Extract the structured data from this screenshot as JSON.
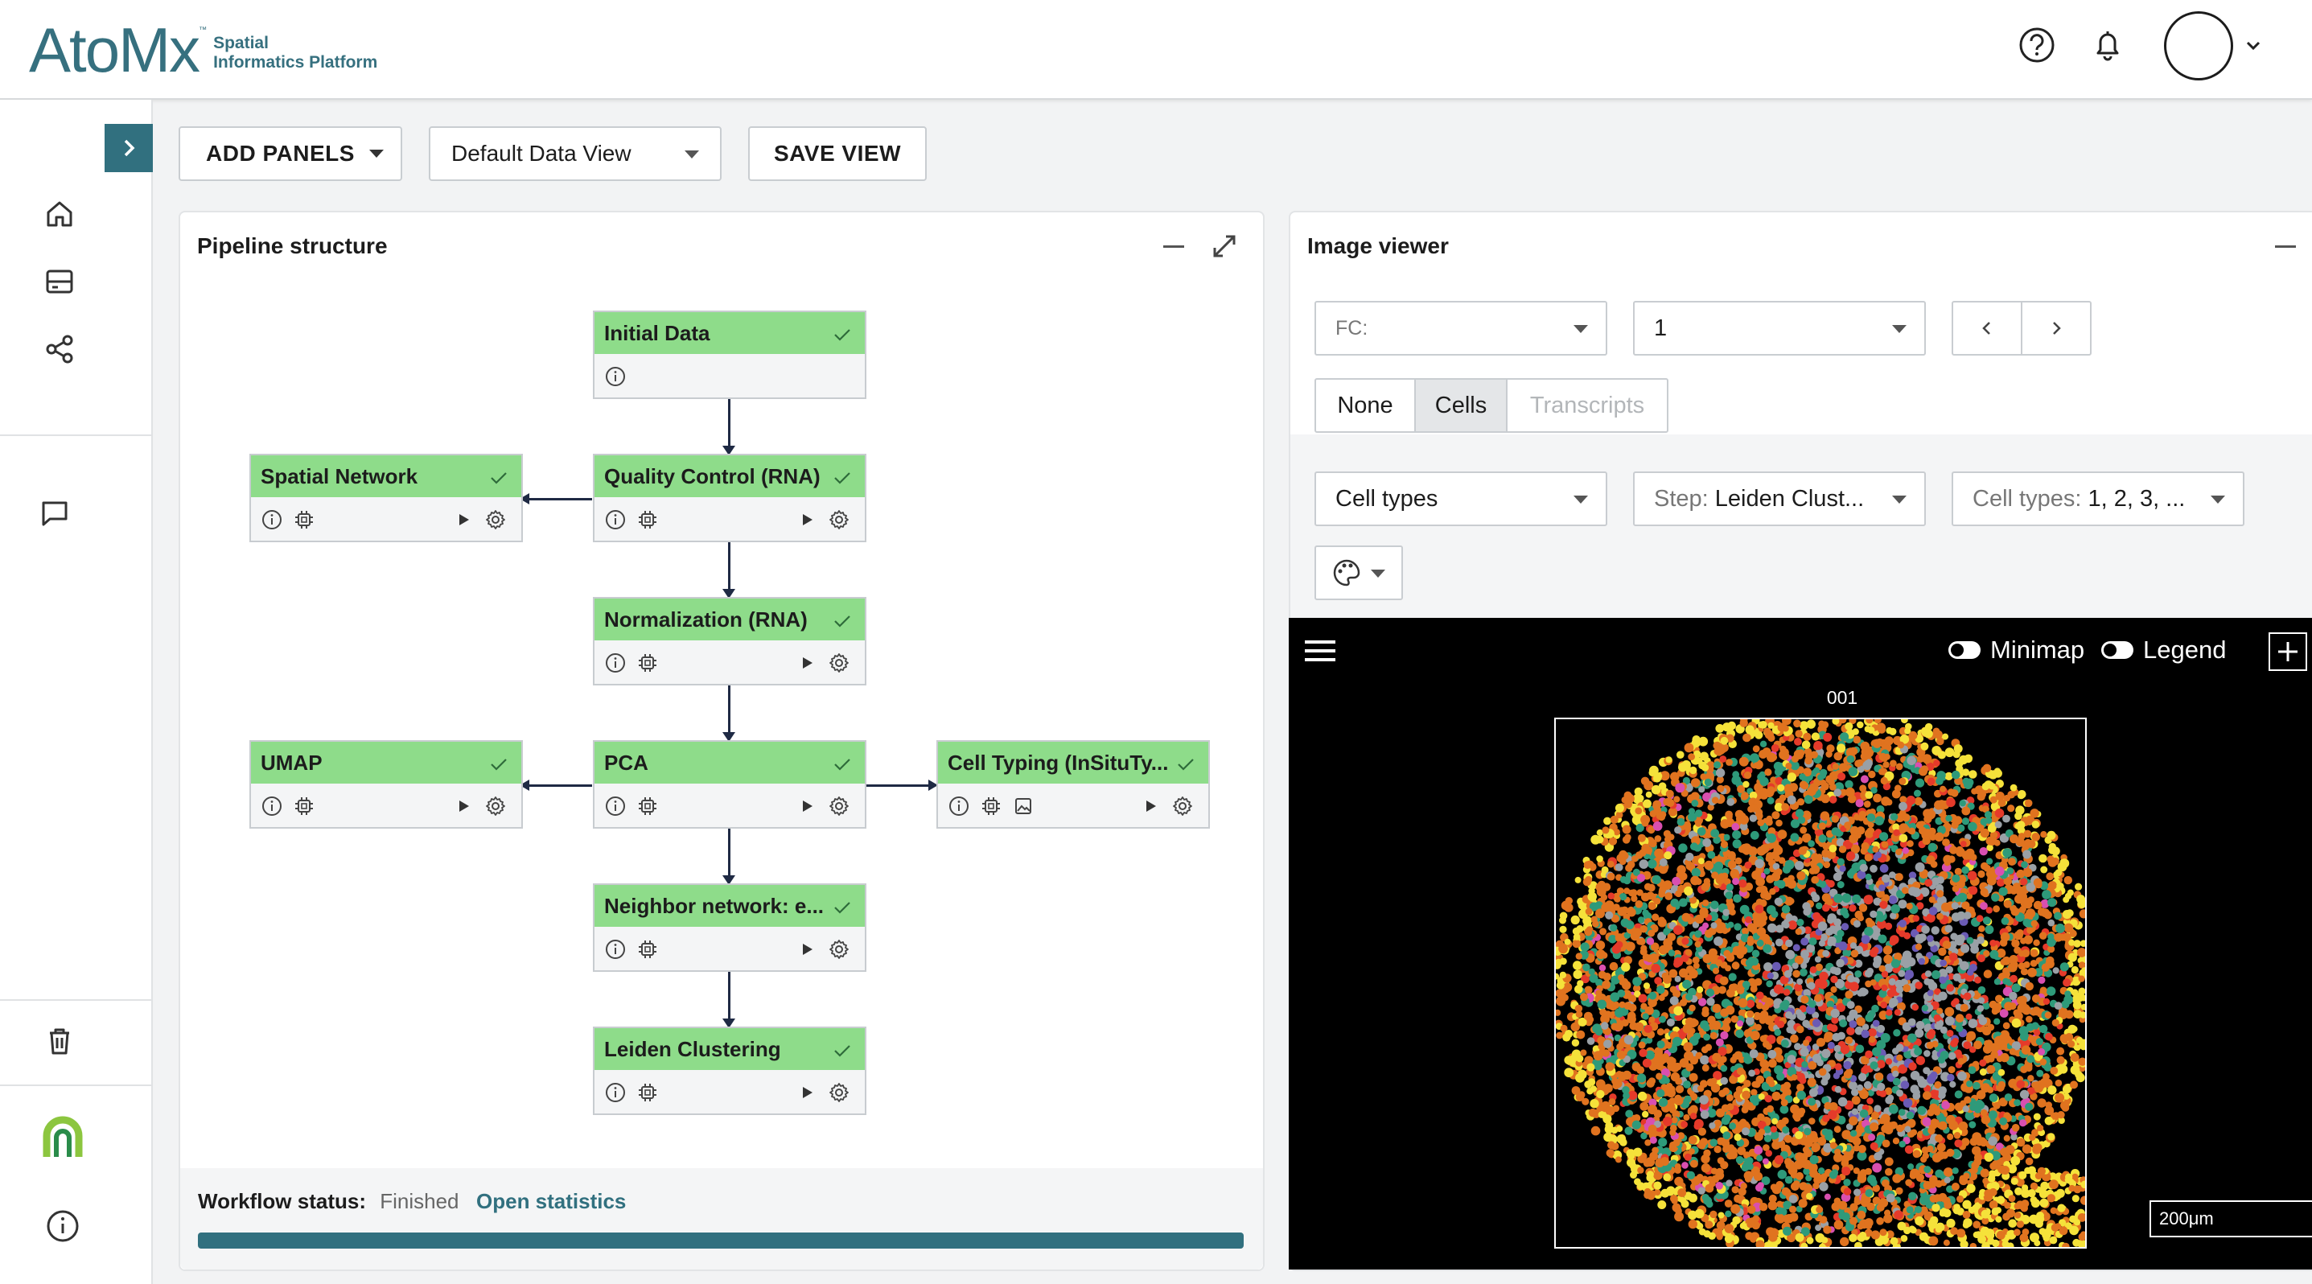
{
  "app": {
    "logo_main": "AtoMx",
    "logo_tm": "™",
    "logo_sub_line1": "Spatial",
    "logo_sub_line2": "Informatics Platform"
  },
  "header": {
    "help_icon": "help-circle-icon",
    "notifications_icon": "bell-icon",
    "avatar_icon": "user-avatar",
    "menu_icon": "chevron-down-icon"
  },
  "toolbar": {
    "add_panels": "ADD PANELS",
    "data_view": "Default Data View",
    "save_view": "SAVE VIEW"
  },
  "pipeline": {
    "title": "Pipeline structure",
    "nodes": {
      "initial": "Initial Data",
      "spatial_network": "Spatial Network",
      "quality_control": "Quality Control (RNA)",
      "normalization": "Normalization (RNA)",
      "umap": "UMAP",
      "pca": "PCA",
      "cell_typing": "Cell Typing (InSituTy...",
      "neighbor": "Neighbor network: e...",
      "leiden": "Leiden Clustering"
    },
    "status_label": "Workflow status:",
    "status_value": "Finished",
    "open_statistics": "Open statistics",
    "progress_fraction": 1.0
  },
  "image_viewer": {
    "title": "Image viewer",
    "fc_select": "FC:",
    "fov_select": "1",
    "seg_none": "None",
    "seg_cells": "Cells",
    "seg_transcripts": "Transcripts",
    "color_by": "Cell types",
    "step_label": "Step:",
    "step_value": "Leiden Clust...",
    "cell_types_label": "Cell types:",
    "cell_types_value": "1, 2, 3, ...",
    "minimap": "Minimap",
    "legend": "Legend",
    "fov_label": "001",
    "scale": "200μm",
    "cluster_colors": [
      "#e0731f",
      "#2e9a7a",
      "#9aa0a6",
      "#e53a2a",
      "#f5e23a",
      "#6b5bb5",
      "#d94fb0"
    ]
  }
}
